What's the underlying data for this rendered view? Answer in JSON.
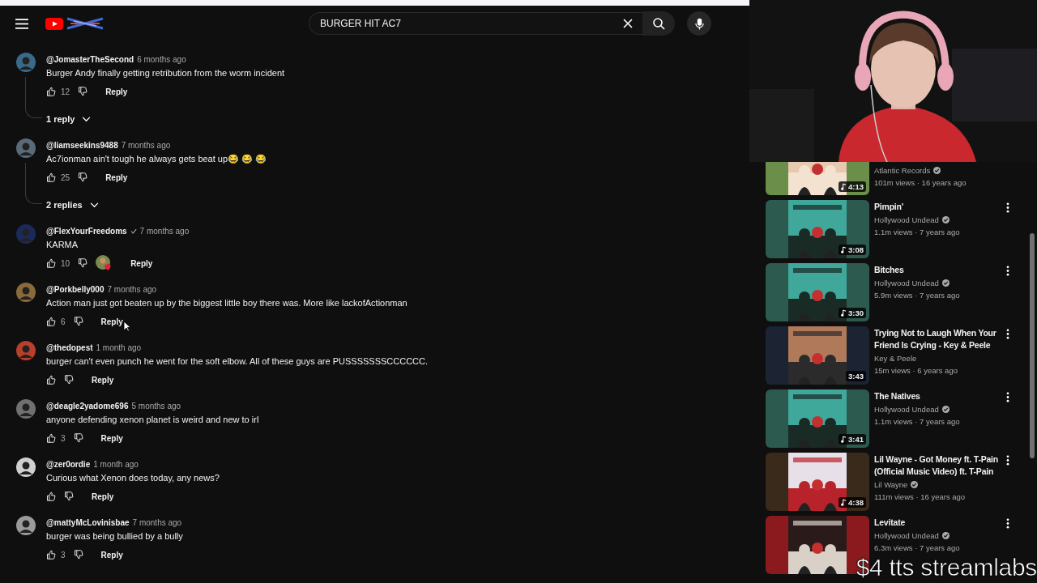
{
  "header": {
    "search": {
      "value": "BURGER HIT AC7"
    }
  },
  "comments": [
    {
      "author": "@JomasterTheSecond",
      "verified": false,
      "time": "6 months ago",
      "text": "Burger Andy finally getting retribution from the worm incident",
      "likes": "12",
      "hearted": false,
      "reply": "Reply",
      "replies": "1 reply"
    },
    {
      "author": "@liamseekins9488",
      "verified": false,
      "time": "7 months ago",
      "text": "Ac7ionman ain't tough he always gets beat up😂 😂 😂",
      "likes": "25",
      "hearted": false,
      "reply": "Reply",
      "replies": "2 replies"
    },
    {
      "author": "@FlexYourFreedoms",
      "verified": true,
      "time": "7 months ago",
      "text": "KARMA",
      "likes": "10",
      "hearted": true,
      "reply": "Reply"
    },
    {
      "author": "@Porkbelly000",
      "verified": false,
      "time": "7 months ago",
      "text": "Action man just got beaten up by the biggest little boy there was.  More like lackofActionman",
      "likes": "6",
      "hearted": false,
      "reply": "Reply"
    },
    {
      "author": "@thedopest",
      "verified": false,
      "time": "1 month ago",
      "text": "burger can't even punch he went for the soft elbow. All of these guys are PUSSSSSSSCCCCCC.",
      "hearted": false,
      "reply": "Reply"
    },
    {
      "author": "@deagle2yadome696",
      "verified": false,
      "time": "5 months ago",
      "text": "anyone defending xenon planet is weird and new to irl",
      "likes": "3",
      "hearted": false,
      "reply": "Reply"
    },
    {
      "author": "@zer0ordie",
      "verified": false,
      "time": "1 month ago",
      "text": "Curious what Xenon  does today, any news?",
      "hearted": false,
      "reply": "Reply"
    },
    {
      "author": "@mattyMcLovinisbae",
      "verified": false,
      "time": "7 months ago",
      "text": "burger was being bullied by a bully",
      "likes": "3",
      "hearted": false,
      "reply": "Reply"
    }
  ],
  "videos": [
    {
      "channel": "Atlantic Records",
      "verified": true,
      "meta": "101m views · 16 years ago",
      "duration": "4:13",
      "music": true
    },
    {
      "title": "Pimpin'",
      "channel": "Hollywood Undead",
      "verified": true,
      "meta": "1.1m views · 7 years ago",
      "duration": "3:08",
      "music": true
    },
    {
      "title": "Bitches",
      "channel": "Hollywood Undead",
      "verified": true,
      "meta": "5.9m views · 7 years ago",
      "duration": "3:30",
      "music": true
    },
    {
      "title": "Trying Not to Laugh When Your Friend Is Crying - Key & Peele",
      "channel": "Key & Peele",
      "verified": false,
      "meta": "15m views · 6 years ago",
      "duration": "3:43",
      "music": false
    },
    {
      "title": "The Natives",
      "channel": "Hollywood Undead",
      "verified": true,
      "meta": "1.1m views · 7 years ago",
      "duration": "3:41",
      "music": true
    },
    {
      "title": "Lil Wayne - Got Money ft. T-Pain (Official Music Video) ft. T-Pain",
      "channel": "Lil Wayne",
      "verified": true,
      "meta": "111m views · 16 years ago",
      "duration": "4:38",
      "music": true
    },
    {
      "title": "Levitate",
      "channel": "Hollywood Undead",
      "verified": true,
      "meta": "6.3m views · 7 years ago",
      "music": false
    }
  ],
  "overlay": {
    "text": "$4 tts streamlabs"
  }
}
